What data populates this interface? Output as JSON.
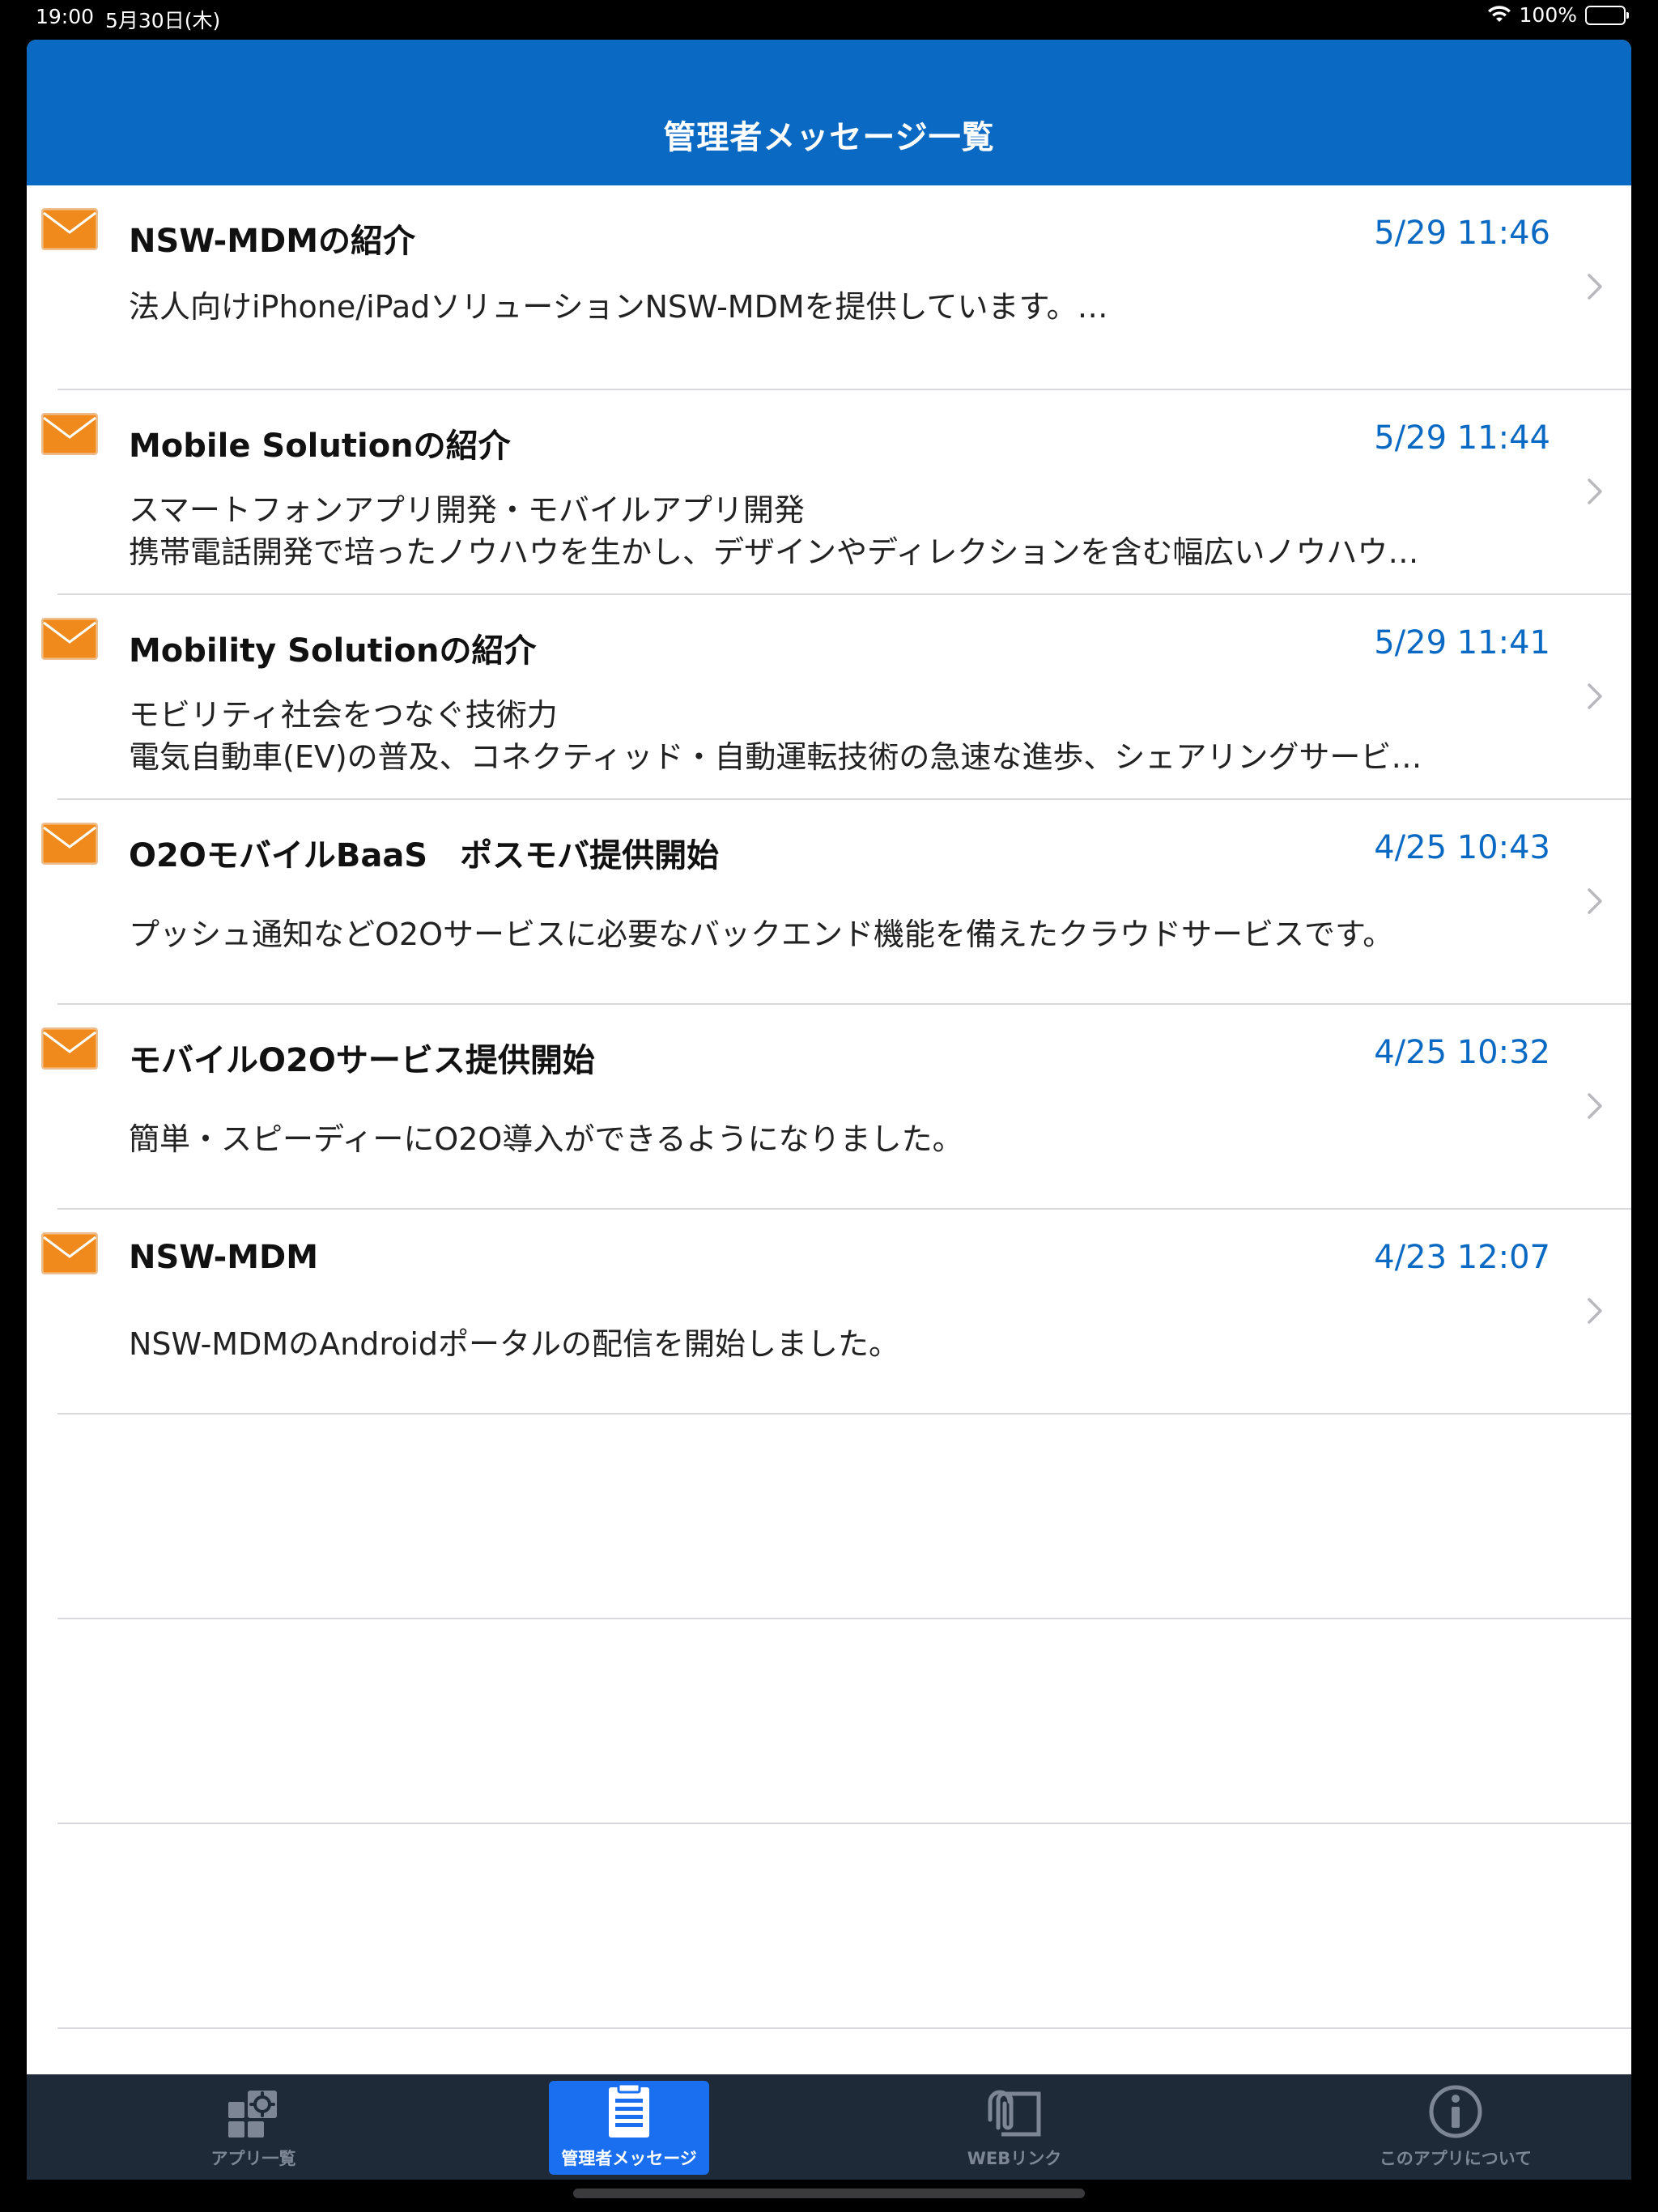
{
  "status_bar": {
    "time": "19:00",
    "date": "5月30日(木)",
    "battery": "100%"
  },
  "nav": {
    "title": "管理者メッセージ一覧"
  },
  "messages": [
    {
      "title": "NSW-MDMの紹介",
      "date": "5/29 11:46",
      "lines": [
        "法人向けiPhone/iPadソリューションNSW-MDMを提供しています。…"
      ]
    },
    {
      "title": "Mobile Solutionの紹介",
      "date": "5/29 11:44",
      "lines": [
        "スマートフォンアプリ開発・モバイルアプリ開発",
        "携帯電話開発で培ったノウハウを生かし、デザインやディレクションを含む幅広いノウハウ…"
      ]
    },
    {
      "title": "Mobility Solutionの紹介",
      "date": "5/29 11:41",
      "lines": [
        "モビリティ社会をつなぐ技術力",
        "電気自動車(EV)の普及、コネクティッド・自動運転技術の急速な進歩、シェアリングサービ…"
      ]
    },
    {
      "title": "O2OモバイルBaaS　ポスモバ提供開始",
      "date": "4/25 10:43",
      "lines": [
        "プッシュ通知などO2Oサービスに必要なバックエンド機能を備えたクラウドサービスです。"
      ]
    },
    {
      "title": "モバイルO2Oサービス提供開始",
      "date": "4/25 10:32",
      "lines": [
        "簡単・スピーディーにO2O導入ができるようになりました。"
      ]
    },
    {
      "title": "NSW-MDM",
      "date": "4/23 12:07",
      "lines": [
        "NSW-MDMのAndroidポータルの配信を開始しました。"
      ]
    }
  ],
  "tabs": [
    {
      "label": "アプリ一覧",
      "icon": "app-grid-gear-icon",
      "active": false
    },
    {
      "label": "管理者メッセージ",
      "icon": "clipboard-list-icon",
      "active": true
    },
    {
      "label": "WEBリンク",
      "icon": "paperclip-icon",
      "active": false
    },
    {
      "label": "このアプリについて",
      "icon": "info-icon",
      "active": false
    }
  ],
  "colors": {
    "nav_bar": "#0a6ac3",
    "date_text": "#0a6ac3",
    "tab_bar": "#1e2a38",
    "tab_active": "#1a6ff0",
    "mail_icon": "#f08a1c"
  }
}
